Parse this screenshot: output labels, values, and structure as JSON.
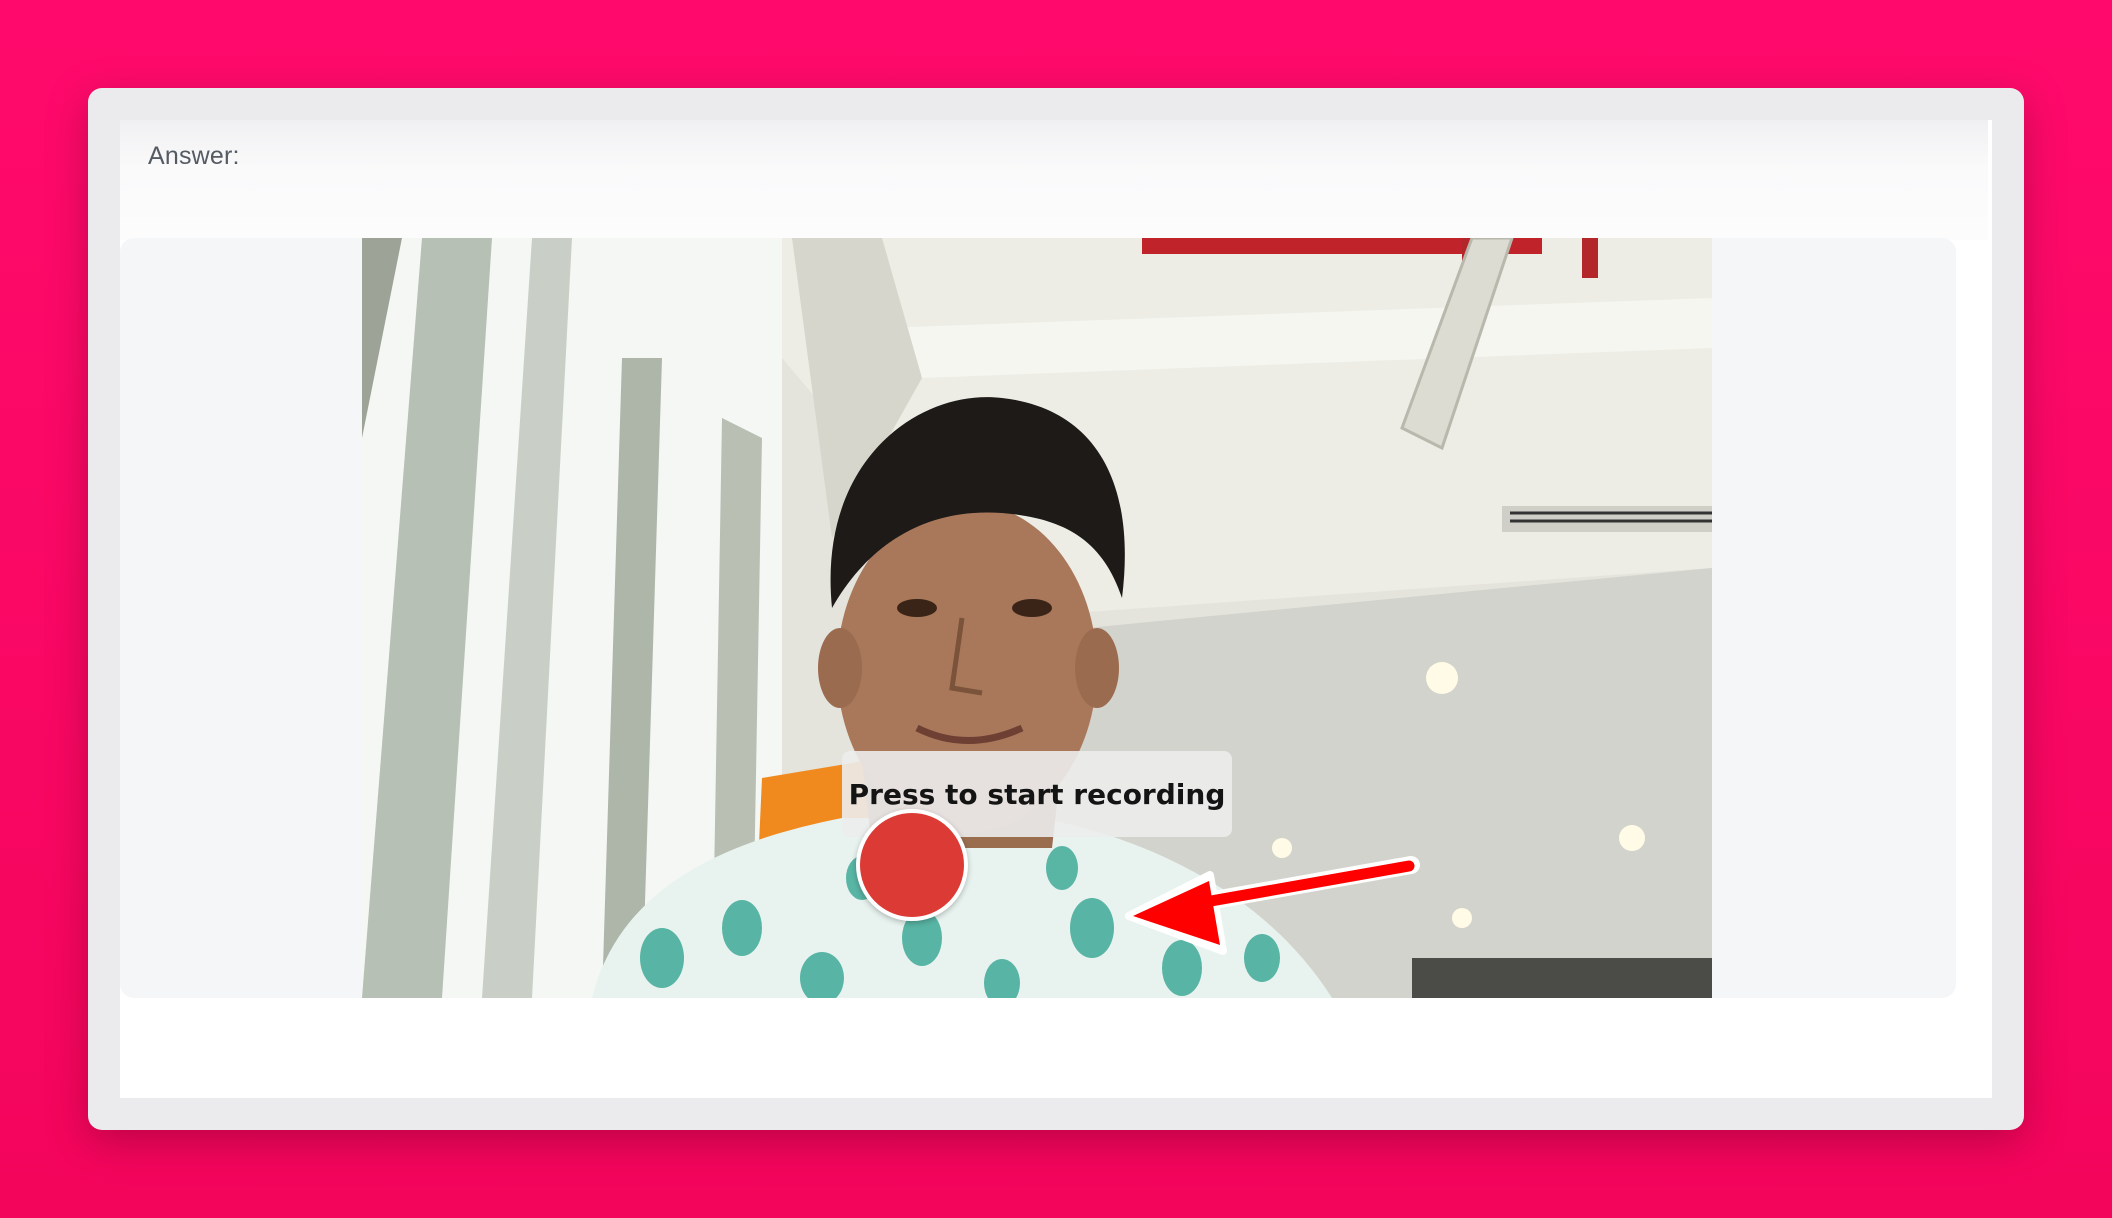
{
  "answer": {
    "label": "Answer:"
  },
  "recorder": {
    "tooltip": "Press to start recording",
    "record_button_color": "#dc3a34"
  },
  "annotation": {
    "icon": "red-arrow-icon",
    "color": "#ff0000"
  },
  "colors": {
    "background": "#ff0a6c",
    "window": "#ebebed"
  }
}
